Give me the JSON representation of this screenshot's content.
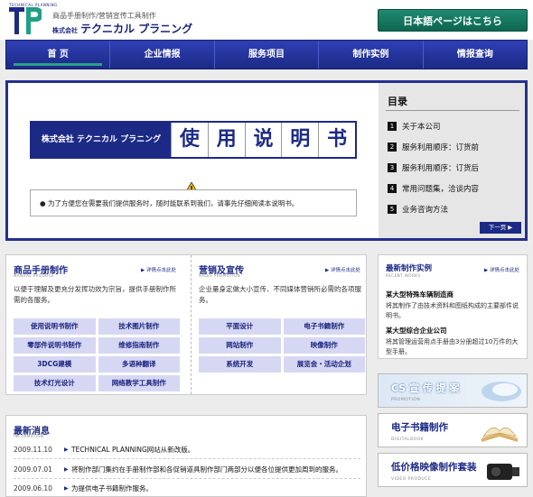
{
  "header": {
    "logo_mark": "TP",
    "logo_sub": "TECHNICAL PLANNING",
    "tagline": "商品手册制作/营销宣传工具制作",
    "company_prefix": "株式会社",
    "company_name": "テクニカル プラニング",
    "japanese_button": "日本語ページはこちら"
  },
  "nav": {
    "items": [
      "首 页",
      "企业情报",
      "服务项目",
      "制作实例",
      "情报查询"
    ]
  },
  "hero": {
    "banner_company": "株式会社 テクニカル プラニング",
    "banner_title_chars": [
      "使",
      "用",
      "说",
      "明",
      "书"
    ],
    "notice": "为了方便您在需要我们提供服务时，随时能联系到我们，请事先仔细阅读本说明书。",
    "toc_title": "目录",
    "toc": [
      {
        "num": "1",
        "label": "关于本公司"
      },
      {
        "num": "2",
        "label": "服务利用顺序：订货前"
      },
      {
        "num": "3",
        "label": "服务利用顺序：订货后"
      },
      {
        "num": "4",
        "label": "常用问题集，洽谈内容"
      },
      {
        "num": "5",
        "label": "业务咨询方法"
      }
    ],
    "next_button": "下一页 ▶"
  },
  "products": {
    "manual": {
      "title": "商品手册制作",
      "sub": "MANUAL PRODUCE",
      "more": "▶ 详情点击此处",
      "desc": "以便于理解及更充分发挥功效为宗旨，提供手册制作所需的各服务。",
      "buttons": [
        "使用说明书制作",
        "技术图片制作",
        "零部件说明书制作",
        "维修指南制作",
        "3DCG建模",
        "多语种翻译",
        "技术灯光设计",
        "网络教学工具制作"
      ]
    },
    "sales": {
      "title": "营销及宣传",
      "sub": "SALES PROMOTION",
      "more": "▶ 详情点击此处",
      "desc": "企业量身定做大小宣传、不同媒体营销所必需的各项服务。",
      "buttons": [
        "平面设计",
        "电子书籍制作",
        "网站制作",
        "映像制作",
        "系统开发",
        "展览会・活动企划"
      ]
    }
  },
  "works": {
    "title": "最新制作实例",
    "sub": "RECENT WORKS",
    "more": "▶ 详情点击此处",
    "items": [
      {
        "title": "某大型特殊车辆制造商",
        "text": "将其制作了由技术资料和图纸构成的主要部件说明书。"
      },
      {
        "title": "某大型综合企业公司",
        "text": "将其管理运营用点手册由3分册超过10万件的大型手册。"
      }
    ]
  },
  "promos": [
    {
      "title": "CS 宣 传 提 案",
      "sub": "PROMOTION"
    },
    {
      "title": "电子书籍制作",
      "sub": "DIGITALBOOK"
    },
    {
      "title": "低价格映像制作套装",
      "sub": "VIDEO PRODUCE"
    }
  ],
  "news": {
    "title": "最新消息",
    "sub": "INFORMATION",
    "items": [
      {
        "date": "2009.11.10",
        "text": "TECHNICAL PLANNING网站从新改版。"
      },
      {
        "date": "2009.07.01",
        "text": "将制作部门集约在手册制作部和各促销道具制作部门两部分以便各位提供更加周到的服务。"
      },
      {
        "date": "2009.06.10",
        "text": "为提供电子书籍制作服务。"
      }
    ]
  },
  "colors": {
    "brand_navy": "#1c2a86",
    "brand_green": "#1f8a70",
    "button_tint": "#d6d8f3"
  }
}
